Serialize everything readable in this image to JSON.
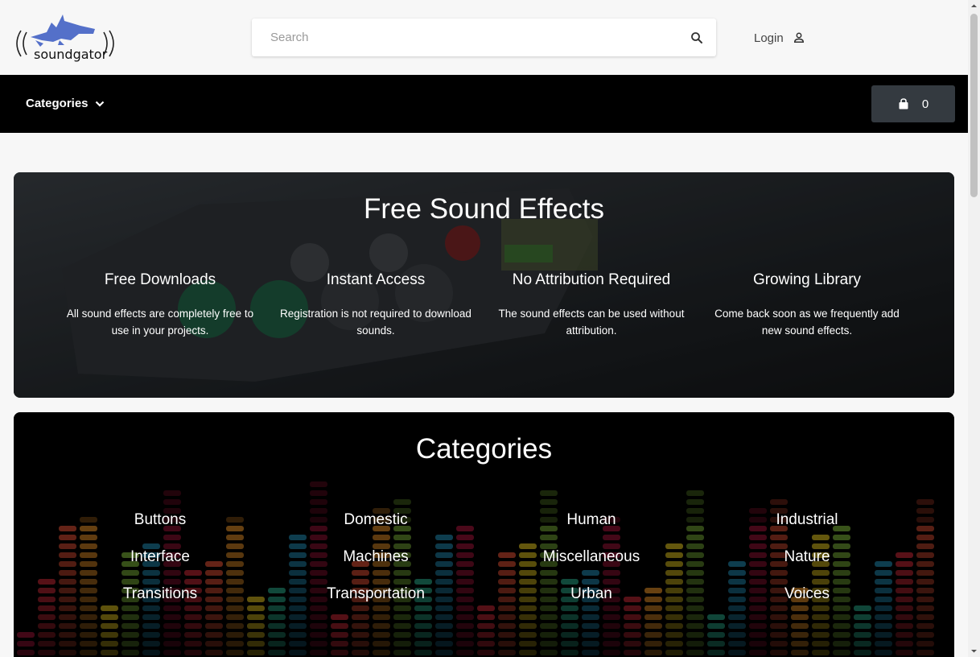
{
  "header": {
    "logo_text": "soundgator",
    "search": {
      "placeholder": "Search",
      "value": ""
    },
    "login_label": "Login"
  },
  "navbar": {
    "categories_label": "Categories",
    "cart_count": "0"
  },
  "hero": {
    "title": "Free Sound Effects",
    "features": [
      {
        "title": "Free Downloads",
        "desc": "All sound effects are completely free to use in your projects."
      },
      {
        "title": "Instant Access",
        "desc": "Registration is not required to download sounds."
      },
      {
        "title": "No Attribution Required",
        "desc": "The sound effects can be used without attribution."
      },
      {
        "title": "Growing Library",
        "desc": "Come back soon as we frequently add new sound effects."
      }
    ]
  },
  "categories": {
    "title": "Categories",
    "items": [
      "Buttons",
      "Domestic",
      "Human",
      "Industrial",
      "Interface",
      "Machines",
      "Miscellaneous",
      "Nature",
      "Transitions",
      "Transportation",
      "Urban",
      "Voices"
    ]
  },
  "colors": {
    "navbar_bg": "#000000",
    "cart_button_bg": "#343a40",
    "logo_gator": "#5470c9"
  },
  "icons": [
    "gator-logo-icon",
    "search-icon",
    "user-icon",
    "chevron-down-icon",
    "shopping-bag-icon"
  ]
}
